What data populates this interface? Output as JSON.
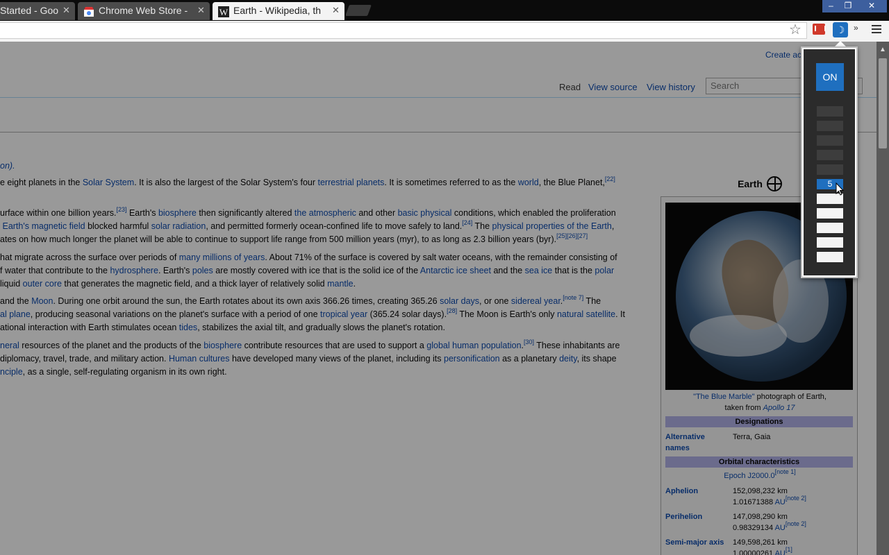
{
  "browser": {
    "tabs": [
      {
        "title": "Started - Goo",
        "close": "✕"
      },
      {
        "title": "Chrome Web Store -",
        "close": "✕"
      },
      {
        "title": "Earth - Wikipedia, th",
        "close": "✕"
      }
    ],
    "window_buttons": {
      "minimize": "–",
      "maximize": "❐",
      "close": "✕"
    },
    "star": "☆",
    "dark_ext_icon": "☽",
    "more_ext": "»"
  },
  "popup": {
    "on_label": "ON",
    "selected_level": "5",
    "accent_color": "#1f6fbf"
  },
  "page": {
    "create_account": "Create account",
    "tabs": {
      "read": "Read",
      "view_source": "View source",
      "view_history": "View history"
    },
    "search_placeholder": "Search"
  },
  "article": {
    "l0": "on).",
    "l1a": "e eight planets in the ",
    "l1b": "Solar System",
    "l1c": ". It is also the largest of the Solar System's four ",
    "l1d": "terrestrial planets",
    "l1e": ". It is sometimes referred to as the ",
    "l1f": "world",
    "l1g": ", the Blue Planet,",
    "l1s": "[22]",
    "l2a": "urface within one billion years.",
    "l2s": "[23]",
    "l2b": " Earth's ",
    "l2c": "biosphere",
    "l2d": " then significantly altered ",
    "l2e": "the atmospheric",
    "l2f": " and other ",
    "l2g": "basic physical",
    "l2h": " conditions, which enabled the proliferation",
    "l3a": "Earth's magnetic field",
    "l3b": " blocked harmful ",
    "l3c": "solar radiation",
    "l3d": ", and permitted formerly ocean-confined life to move safely to land.",
    "l3s": "[24]",
    "l3e": " The ",
    "l3f": "physical properties of the Earth",
    "l3g": ",",
    "l4a": "ates on how much longer the planet will be able to continue to support life range from 500 million years (myr), to as long as 2.3 billion years (byr).",
    "l4s": "[25][26][27]",
    "l5a": "hat migrate across the surface over periods of ",
    "l5b": "many millions of years",
    "l5c": ". About 71% of the surface is covered by salt water oceans, with the remainder consisting of",
    "l6a": "f water that contribute to the ",
    "l6b": "hydrosphere",
    "l6c": ". Earth's ",
    "l6d": "poles",
    "l6e": " are mostly covered with ice that is the solid ice of the ",
    "l6f": "Antarctic ice sheet",
    "l6g": " and the ",
    "l6h": "sea ice",
    "l6i": " that is the ",
    "l6j": "polar",
    "l7a": "liquid ",
    "l7b": "outer core",
    "l7c": " that generates the magnetic field, and a thick layer of relatively solid ",
    "l7d": "mantle",
    "l7e": ".",
    "l8a": " and the ",
    "l8b": "Moon",
    "l8c": ". During one orbit around the sun, the Earth rotates about its own axis 366.26 times, creating 365.26 ",
    "l8d": "solar days",
    "l8e": ", or one ",
    "l8f": "sidereal year",
    "l8g": ".",
    "l8s": "[note 7]",
    "l8h": " The",
    "l9a": "al plane",
    "l9b": ", producing seasonal variations on the planet's surface with a period of one ",
    "l9c": "tropical year",
    "l9d": " (365.24 solar days).",
    "l9s": "[28]",
    "l9e": " The Moon is Earth's only ",
    "l9f": "natural satellite",
    "l9g": ". It",
    "l10a": "ational interaction with Earth stimulates ocean ",
    "l10b": "tides",
    "l10c": ", stabilizes the axial tilt, and gradually slows the planet's rotation.",
    "l11a": "neral",
    "l11b": " resources of the planet and the products of the ",
    "l11c": "biosphere",
    "l11d": " contribute resources that are used to support a ",
    "l11e": "global human population",
    "l11f": ".",
    "l11s": "[30]",
    "l11g": " These inhabitants are",
    "l12a": " diplomacy, travel, trade, and military action. ",
    "l12b": "Human cultures",
    "l12c": " have developed many views of the planet, including its ",
    "l12d": "personification",
    "l12e": " as a planetary ",
    "l12f": "deity",
    "l12g": ", its shape",
    "l13a": "nciple",
    "l13b": ", as a single, self-regulating organism in its own right."
  },
  "infobox": {
    "title": "Earth",
    "caption_link": "\"The Blue Marble\"",
    "caption_text": " photograph of Earth,",
    "caption_line2": "taken from ",
    "caption_apollo": "Apollo 17",
    "designations": "Designations",
    "alt_names_label": "Alternative names",
    "alt_names_value": "Terra, Gaia",
    "orbital": "Orbital characteristics",
    "epoch": "Epoch J2000.0",
    "epoch_note": "[note 1]",
    "aphelion_label": "Aphelion",
    "aphelion_v1": "152,098,232 km",
    "aphelion_v2": "1.01671388 ",
    "au": "AU",
    "note2": "[note 2]",
    "perihelion_label": "Perihelion",
    "perihelion_v1": "147,098,290 km",
    "perihelion_v2": "0.98329134 ",
    "sma_label": "Semi-major axis",
    "sma_v1": "149,598,261 km",
    "sma_v2": "1.00000261 ",
    "note1": "[1]"
  }
}
